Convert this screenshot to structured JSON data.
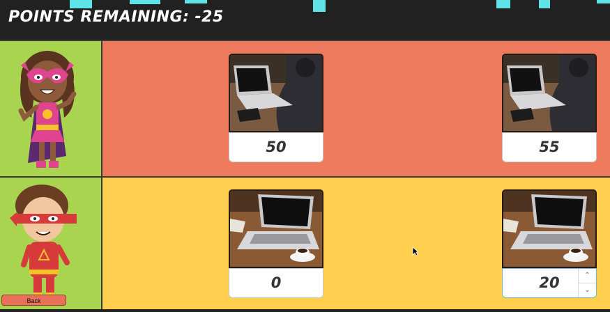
{
  "header": {
    "title": "POINTS REMAINING: -25",
    "accent_color": "#5ee3e6"
  },
  "rows": [
    {
      "character": "superhero-girl-purple-mask",
      "background": "#ef7b5f",
      "cards": [
        {
          "image": "laptop-person-typing-photo",
          "value": "50"
        },
        {
          "image": "laptop-person-typing-photo",
          "value": "55"
        }
      ]
    },
    {
      "character": "superhero-boy-red-mask",
      "background": "#fecf4f",
      "cards": [
        {
          "image": "laptop-coffee-photo",
          "value": "0"
        },
        {
          "image": "laptop-coffee-photo",
          "value": "20"
        }
      ]
    }
  ],
  "back_button": {
    "label": "Back"
  },
  "colors": {
    "avatar_bg": "#a8d44f",
    "header_bg": "#212121"
  }
}
